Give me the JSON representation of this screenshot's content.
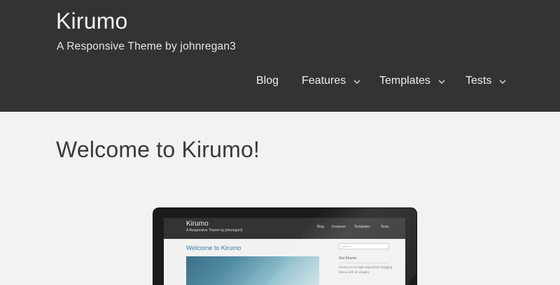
{
  "site": {
    "title": "Kirumo",
    "tagline": "A Responsive Theme by johnregan3"
  },
  "nav": {
    "items": [
      {
        "label": "Blog",
        "has_dropdown": false
      },
      {
        "label": "Features",
        "has_dropdown": true
      },
      {
        "label": "Templates",
        "has_dropdown": true
      },
      {
        "label": "Tests",
        "has_dropdown": true
      }
    ]
  },
  "page": {
    "title": "Welcome to Kirumo!"
  },
  "monitor_preview": {
    "site_title": "Kirumo",
    "tagline": "A Responsive Theme by johnregan3",
    "nav": [
      "Blog",
      "Features",
      "Templates",
      "Tests"
    ],
    "heading": "Welcome to Kirumo",
    "search_placeholder": "Search...",
    "sidebar_title": "Get Kirumo",
    "sidebar_text": "Kirumo is a simple responsive blogging theme with an elegant"
  },
  "colors": {
    "header_bg": "#333333",
    "page_bg": "#f3f3f3",
    "link_blue": "#3a7ca5"
  }
}
